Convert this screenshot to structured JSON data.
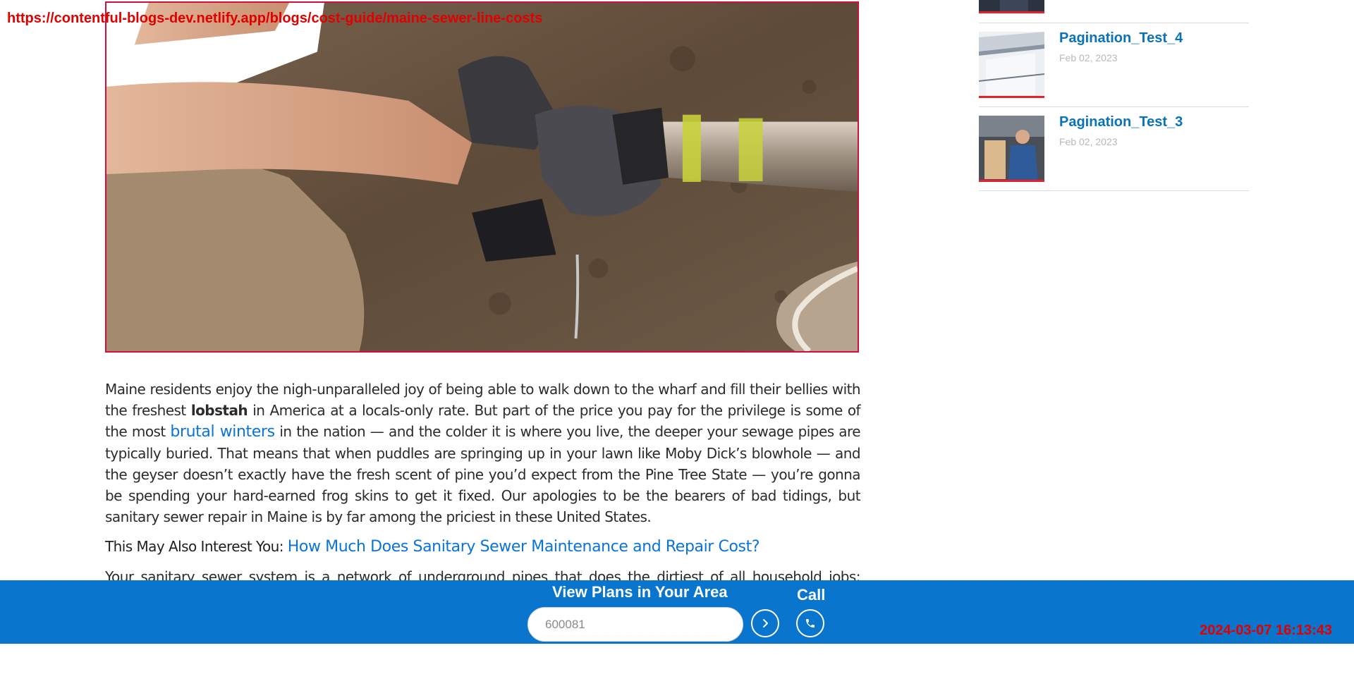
{
  "overlay": {
    "url": "https://contentful-blogs-dev.netlify.app/blogs/cost-guide/maine-sewer-line-costs",
    "timestamp": "2024-03-07 16:13:43"
  },
  "hero": {
    "icon": "sewer-pipe-repair-photo"
  },
  "article": {
    "p1": {
      "t1": "Maine residents enjoy the nigh-unparalleled joy of being able to walk down to the wharf and fill their bellies with the freshest ",
      "bold": "lobstah",
      "t2": " in America at a locals-only rate. But part of the price you pay for the privilege is some of the most ",
      "link": "brutal winters",
      "t3": " in the nation — and the colder it is where you live, the deeper your sewage pipes are typically buried. That means that when puddles are springing up in your lawn like Moby Dick’s blowhole — and the geyser doesn’t exactly have the fresh scent of pine you’d expect from the Pine Tree State — you’re gonna be spending your hard-earned frog skins to get it fixed. Our apologies to be the bearers of bad tidings, but sanitary sewer repair in Maine is by far among the priciest in these United States."
    },
    "related": {
      "label": "This May Also Interest You: ",
      "link": "How Much Does Sanitary Sewer Maintenance and Repair Cost?"
    },
    "p2_partial": "Your sanitary sewer system is a network of underground pipes that does the dirtiest of all household jobs: carrying"
  },
  "sidebar": {
    "items": [
      {
        "title": "Pagination_Test_4",
        "date": "Feb 02, 2023",
        "icon": "house-gutter-thumbnail"
      },
      {
        "title": "Pagination_Test_3",
        "date": "Feb 02, 2023",
        "icon": "technician-thumbnail"
      }
    ]
  },
  "cta": {
    "title": "View Plans in Your Area",
    "zip_value": "600081",
    "call_label": "Call",
    "go_icon": "chevron-right-icon",
    "call_icon": "phone-icon"
  },
  "colors": {
    "brand_blue": "#0975cd",
    "link_blue": "#0a73d9",
    "accent_red": "#e8202c"
  }
}
